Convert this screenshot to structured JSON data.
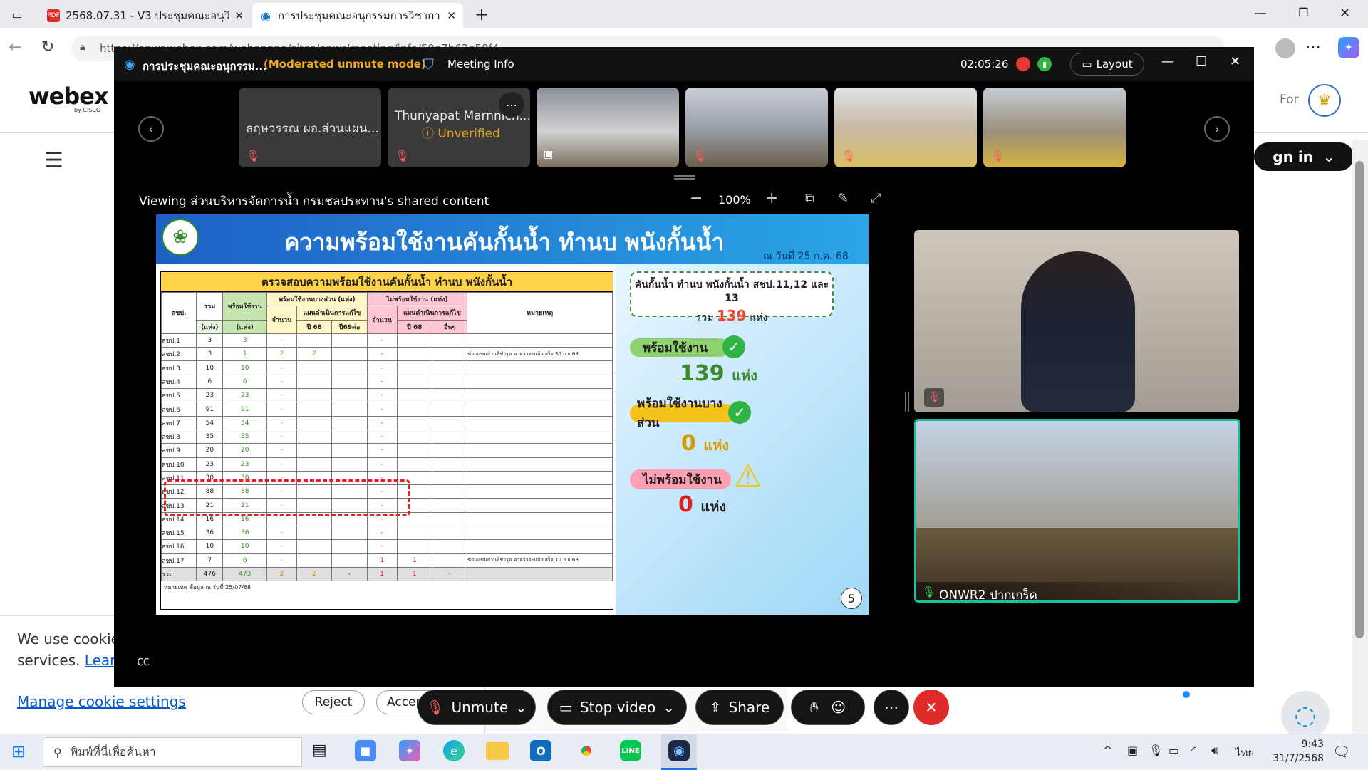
{
  "browser": {
    "tabs": [
      {
        "title": "2568.07.31 - V3 ประชุมคณะอนุวิชาก",
        "icon": "pdf-icon"
      },
      {
        "title": "การประชุมคณะอนุกรรมการวิชาการแล",
        "icon": "webex-icon"
      }
    ],
    "url": "https://onwr.webex.com/webappng/sites/onwr/meeting/info/59e7b63e59f4..."
  },
  "page": {
    "logo": "webex",
    "logo_sub": "by CISCO",
    "for_text": "For",
    "sign_in": "gn in",
    "cookie_text_1": "We use cookie",
    "cookie_text_2": "services.",
    "cookie_learn": "Learn",
    "manage_cookie": "Manage cookie settings",
    "reject": "Reject",
    "accept": "Accept"
  },
  "meeting": {
    "title": "การประชุมคณะอนุกรรม...",
    "mode": "(Moderated unmute mode)",
    "info": "Meeting Info",
    "timer": "02:05:26",
    "layout": "Layout",
    "share_banner": "Viewing ส่วนบริหารจัดการน้ำ กรมชลประทาน's shared content",
    "zoom": "100%",
    "participants": [
      {
        "name": "ธฤษวรรณ ผอ.ส่วนแผน...",
        "sub": ""
      },
      {
        "name": "Thunyapat Marnnich...",
        "sub": "Unverified"
      }
    ],
    "video_bottom_name": "ONWR2 ปากเกร็ด",
    "controls": {
      "unmute": "Unmute",
      "stop_video": "Stop video",
      "share": "Share"
    }
  },
  "slide": {
    "title": "ความพร้อมใช้งานคันกั้นน้ำ ทำนบ พนังกั้นน้ำ",
    "date": "ณ วันที่ 25 ก.ค. 68",
    "table_title": "ตรวจสอบความพร้อมใช้งานคันกั้นน้ำ ทำนบ พนังกั้นน้ำ",
    "headers": {
      "sob": "สชป.",
      "total": "รวม",
      "total_unit": "(แห่ง)",
      "ready": "พร้อมใช้งาน",
      "ready_unit": "(แห่ง)",
      "partial": "พร้อมใช้งานบางส่วน (แห่ง)",
      "not_ready": "ไม่พร้อมใช้งาน (แห่ง)",
      "count": "จำนวน",
      "plan": "แผนดำเนินการแก้ไข",
      "y68": "ปี 68",
      "y69": "ปี69ต่อ",
      "other": "อื่นๆ",
      "note": "หมายเหตุ"
    },
    "rows": [
      {
        "sob": "สชป.1",
        "total": "3",
        "ready": "3",
        "p": "-",
        "py68": "",
        "py69": "",
        "n": "-",
        "ny68": "",
        "nother": "",
        "note": ""
      },
      {
        "sob": "สชป.2",
        "total": "3",
        "ready": "1",
        "p": "2",
        "py68": "2",
        "py69": "",
        "n": "-",
        "ny68": "",
        "nother": "",
        "note": "ซ่อมแซมส่วนที่ชำรุด คาดว่าจะแล้วเสร็จ 30 ก.ย.68"
      },
      {
        "sob": "สชป.3",
        "total": "10",
        "ready": "10",
        "p": "-",
        "py68": "",
        "py69": "",
        "n": "-",
        "ny68": "",
        "nother": "",
        "note": ""
      },
      {
        "sob": "สชป.4",
        "total": "6",
        "ready": "6",
        "p": "-",
        "py68": "",
        "py69": "",
        "n": "-",
        "ny68": "",
        "nother": "",
        "note": ""
      },
      {
        "sob": "สชป.5",
        "total": "23",
        "ready": "23",
        "p": "-",
        "py68": "",
        "py69": "",
        "n": "-",
        "ny68": "",
        "nother": "",
        "note": ""
      },
      {
        "sob": "สชป.6",
        "total": "91",
        "ready": "91",
        "p": "-",
        "py68": "",
        "py69": "",
        "n": "-",
        "ny68": "",
        "nother": "",
        "note": ""
      },
      {
        "sob": "สชป.7",
        "total": "54",
        "ready": "54",
        "p": "-",
        "py68": "",
        "py69": "",
        "n": "-",
        "ny68": "",
        "nother": "",
        "note": ""
      },
      {
        "sob": "สชป.8",
        "total": "35",
        "ready": "35",
        "p": "-",
        "py68": "",
        "py69": "",
        "n": "-",
        "ny68": "",
        "nother": "",
        "note": ""
      },
      {
        "sob": "สชป.9",
        "total": "20",
        "ready": "20",
        "p": "-",
        "py68": "",
        "py69": "",
        "n": "-",
        "ny68": "",
        "nother": "",
        "note": ""
      },
      {
        "sob": "สชป.10",
        "total": "23",
        "ready": "23",
        "p": "-",
        "py68": "",
        "py69": "",
        "n": "-",
        "ny68": "",
        "nother": "",
        "note": ""
      },
      {
        "sob": "สชป.11",
        "total": "30",
        "ready": "30",
        "p": "-",
        "py68": "",
        "py69": "",
        "n": "-",
        "ny68": "",
        "nother": "",
        "note": ""
      },
      {
        "sob": "สชป.12",
        "total": "88",
        "ready": "88",
        "p": "-",
        "py68": "",
        "py69": "",
        "n": "-",
        "ny68": "",
        "nother": "",
        "note": ""
      },
      {
        "sob": "สชป.13",
        "total": "21",
        "ready": "21",
        "p": "-",
        "py68": "",
        "py69": "",
        "n": "-",
        "ny68": "",
        "nother": "",
        "note": ""
      },
      {
        "sob": "สชป.14",
        "total": "16",
        "ready": "16",
        "p": "-",
        "py68": "",
        "py69": "",
        "n": "-",
        "ny68": "",
        "nother": "",
        "note": ""
      },
      {
        "sob": "สชป.15",
        "total": "36",
        "ready": "36",
        "p": "-",
        "py68": "",
        "py69": "",
        "n": "-",
        "ny68": "",
        "nother": "",
        "note": ""
      },
      {
        "sob": "สชป.16",
        "total": "10",
        "ready": "10",
        "p": "-",
        "py68": "",
        "py69": "",
        "n": "-",
        "ny68": "",
        "nother": "",
        "note": ""
      },
      {
        "sob": "สชป.17",
        "total": "7",
        "ready": "6",
        "p": "-",
        "py68": "",
        "py69": "",
        "n": "1",
        "ny68": "1",
        "nother": "",
        "note": "ซ่อมแซมส่วนที่ชำรุด คาดว่าจะแล้วเสร็จ 10 ก.ย.68"
      },
      {
        "sob": "รวม",
        "total": "476",
        "ready": "473",
        "p": "2",
        "py68": "2",
        "py69": "-",
        "n": "1",
        "ny68": "1",
        "nother": "-",
        "note": ""
      }
    ],
    "footnote": "หมายเหตุ ข้อมูล ณ วันที่ 25/07/68",
    "summary_line1": "คันกั้นน้ำ ทำนบ พนังกั้นน้ำ สชป.11,12 และ 13",
    "summary_pre": "รวม",
    "summary_num": "139",
    "summary_post": "แห่ง",
    "ready_label": "พร้อมใช้งาน",
    "ready_value": "139",
    "ready_unit": "แห่ง",
    "partial_label": "พร้อมใช้งานบางส่วน",
    "partial_value": "0",
    "partial_unit": "แห่ง",
    "notready_label": "ไม่พร้อมใช้งาน",
    "notready_value": "0",
    "notready_unit": "แห่ง",
    "page_no": "5"
  },
  "taskbar": {
    "search": "พิมพ์ที่นี่เพื่อค้นหา",
    "time": "9:43",
    "date": "31/7/2568",
    "lang": "ไทย"
  }
}
